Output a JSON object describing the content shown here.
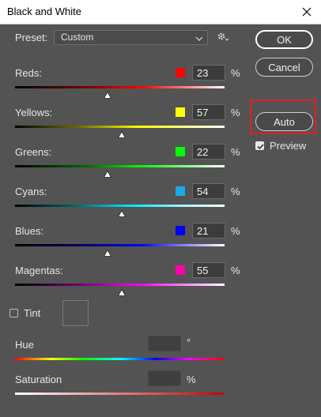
{
  "window": {
    "title": "Black and White"
  },
  "preset": {
    "label": "Preset:",
    "value": "Custom"
  },
  "buttons": {
    "ok": "OK",
    "cancel": "Cancel",
    "auto": "Auto"
  },
  "preview": {
    "label": "Preview",
    "checked": true
  },
  "sliders": [
    {
      "label": "Reds:",
      "value": "23",
      "unit": "%",
      "swatch": "#ff0000",
      "fraction": 0.44,
      "gradient": "linear-gradient(90deg,#000 0%,#7a0000 35%,#ff0000 60%,#ff9999 85%,#ffffff 100%)"
    },
    {
      "label": "Yellows:",
      "value": "57",
      "unit": "%",
      "swatch": "#ffff00",
      "fraction": 0.51,
      "gradient": "linear-gradient(90deg,#000 0%,#6b6b00 30%,#ffff00 60%,#ffffa0 85%,#ffffff 100%)"
    },
    {
      "label": "Greens:",
      "value": "22",
      "unit": "%",
      "swatch": "#00ff00",
      "fraction": 0.44,
      "gradient": "linear-gradient(90deg,#000 0%,#006b00 35%,#00ff00 60%,#a0ffa0 85%,#ffffff 100%)"
    },
    {
      "label": "Cyans:",
      "value": "54",
      "unit": "%",
      "swatch": "#1ca8e8",
      "fraction": 0.51,
      "gradient": "linear-gradient(90deg,#000 0%,#006b6b 30%,#00e5ff 55%,#a0f5ff 80%,#ffffff 100%)"
    },
    {
      "label": "Blues:",
      "value": "21",
      "unit": "%",
      "swatch": "#0000ff",
      "fraction": 0.44,
      "gradient": "linear-gradient(90deg,#000 0%,#00006b 35%,#0000ff 60%,#a0a0ff 85%,#ffffff 100%)"
    },
    {
      "label": "Magentas:",
      "value": "55",
      "unit": "%",
      "swatch": "#ff00aa",
      "fraction": 0.51,
      "gradient": "linear-gradient(90deg,#000 0%,#6b006b 30%,#ff00ff 60%,#ffa0ff 85%,#ffffff 100%)"
    }
  ],
  "tint": {
    "label": "Tint",
    "checked": false
  },
  "hue": {
    "label": "Hue",
    "unit": "°",
    "gradient": "linear-gradient(90deg,#ff0000 0%,#ffff00 17%,#00ff00 33%,#00ffff 50%,#0000ff 67%,#ff00ff 83%,#ff0000 100%)"
  },
  "saturation": {
    "label": "Saturation",
    "unit": "%",
    "gradient": "linear-gradient(90deg,#ffffff 0%,#e08080 50%,#cc0000 100%)"
  },
  "colors": {
    "dialog_bg": "#535353",
    "highlight": "#e01f26"
  },
  "icons": {
    "close": "close-icon",
    "gear": "gear-icon",
    "chevron": "chevron-down-icon",
    "thumb": "slider-thumb-icon",
    "check": "check-icon"
  }
}
